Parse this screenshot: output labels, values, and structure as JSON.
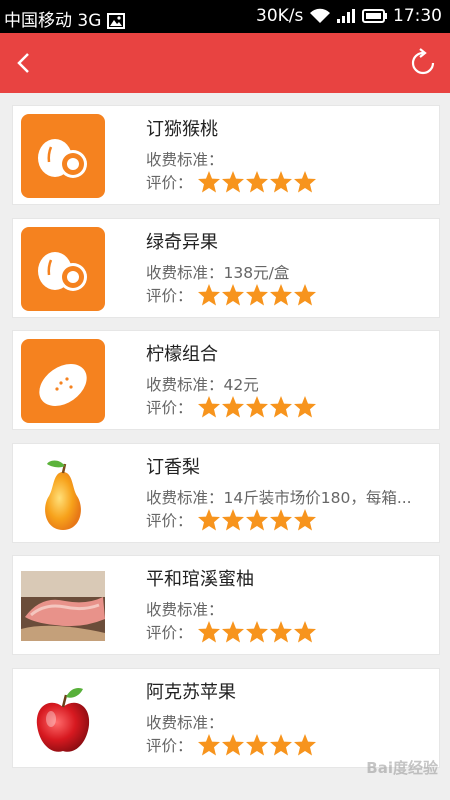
{
  "status_bar": {
    "carrier": "中国移动 3G",
    "speed": "30K/s",
    "time": "17:30"
  },
  "app_bar": {
    "back_icon": "chevron-left-icon",
    "refresh_icon": "refresh-icon"
  },
  "items": [
    {
      "name": "订猕猴桃",
      "fee_label": "收费标准：",
      "fee_value": "",
      "rating_label": "评价：",
      "rating": 5,
      "image": "kiwi-icon"
    },
    {
      "name": "绿奇异果",
      "fee_label": "收费标准：",
      "fee_value": "138元/盒",
      "rating_label": "评价：",
      "rating": 5,
      "image": "kiwi-icon"
    },
    {
      "name": "柠檬组合",
      "fee_label": "收费标准：",
      "fee_value": "42元",
      "rating_label": "评价：",
      "rating": 5,
      "image": "lemon-icon"
    },
    {
      "name": "订香梨",
      "fee_label": "收费标准：",
      "fee_value": "14斤装市场价180，每箱...",
      "rating_label": "评价：",
      "rating": 5,
      "image": "pear-image"
    },
    {
      "name": "平和琯溪蜜柚",
      "fee_label": "收费标准：",
      "fee_value": "",
      "rating_label": "评价：",
      "rating": 5,
      "image": "pomelo-image"
    },
    {
      "name": "阿克苏苹果",
      "fee_label": "收费标准：",
      "fee_value": "",
      "rating_label": "评价：",
      "rating": 5,
      "image": "apple-image"
    }
  ],
  "watermark": "Bai度经验",
  "colors": {
    "app_bar": "#e84341",
    "tile": "#f5821f",
    "star": "#f7941d"
  }
}
